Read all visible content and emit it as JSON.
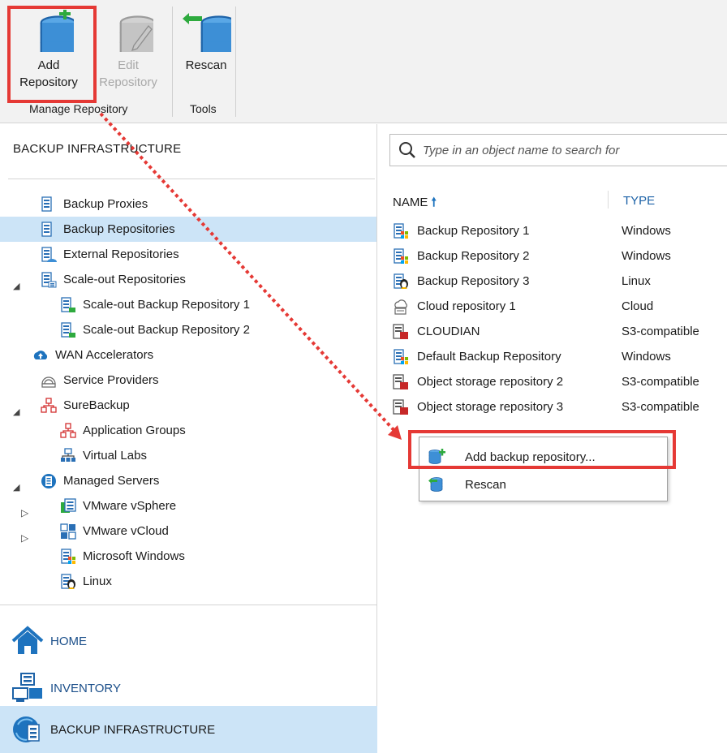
{
  "ribbon": {
    "buttons": {
      "add": {
        "line1": "Add",
        "line2": "Repository"
      },
      "edit": {
        "line1": "Edit",
        "line2": "Repository"
      },
      "rescan": {
        "line1": "Rescan"
      }
    },
    "groups": {
      "manage": "Manage Repository",
      "tools": "Tools"
    }
  },
  "left": {
    "title": "BACKUP INFRASTRUCTURE",
    "tree": [
      {
        "label": "Backup Proxies",
        "icon": "proxy-icon"
      },
      {
        "label": "Backup Repositories",
        "icon": "repository-icon",
        "selected": true
      },
      {
        "label": "External Repositories",
        "icon": "external-repository-icon"
      },
      {
        "label": "Scale-out Repositories",
        "icon": "scaleout-icon",
        "expanded": true
      },
      {
        "label": "Scale-out Backup Repository 1",
        "icon": "scaleout-repo-icon"
      },
      {
        "label": "Scale-out Backup Repository 2",
        "icon": "scaleout-repo-icon"
      },
      {
        "label": "WAN Accelerators",
        "icon": "wan-accelerator-icon"
      },
      {
        "label": "Service Providers",
        "icon": "service-provider-icon"
      },
      {
        "label": "SureBackup",
        "icon": "surebackup-icon",
        "expanded": true
      },
      {
        "label": "Application Groups",
        "icon": "application-group-icon"
      },
      {
        "label": "Virtual Labs",
        "icon": "virtual-lab-icon"
      },
      {
        "label": "Managed Servers",
        "icon": "managed-servers-icon",
        "expanded": true
      },
      {
        "label": "VMware vSphere",
        "icon": "vsphere-icon",
        "collapsed": true
      },
      {
        "label": "VMware vCloud",
        "icon": "vcloud-icon",
        "collapsed": true
      },
      {
        "label": "Microsoft Windows",
        "icon": "windows-server-icon"
      },
      {
        "label": "Linux",
        "icon": "linux-server-icon"
      }
    ],
    "nav": [
      {
        "label": "HOME",
        "icon": "home-icon"
      },
      {
        "label": "INVENTORY",
        "icon": "inventory-icon"
      },
      {
        "label": "BACKUP INFRASTRUCTURE",
        "icon": "backup-infrastructure-icon",
        "selected": true
      }
    ]
  },
  "right": {
    "search": {
      "placeholder": "Type in an object name to search for"
    },
    "columns": {
      "name": "NAME",
      "type": "TYPE"
    },
    "rows": [
      {
        "name": "Backup Repository 1",
        "type": "Windows",
        "icon": "windows-repo-icon"
      },
      {
        "name": "Backup Repository 2",
        "type": "Windows",
        "icon": "windows-repo-icon"
      },
      {
        "name": "Backup Repository 3",
        "type": "Linux",
        "icon": "linux-repo-icon"
      },
      {
        "name": "Cloud repository 1",
        "type": "Cloud",
        "icon": "cloud-repo-icon"
      },
      {
        "name": "CLOUDIAN",
        "type": "S3-compatible",
        "icon": "object-storage-icon"
      },
      {
        "name": "Default Backup Repository",
        "type": "Windows",
        "icon": "windows-repo-icon"
      },
      {
        "name": "Object storage repository 2",
        "type": "S3-compatible",
        "icon": "object-storage-icon"
      },
      {
        "name": "Object storage repository 3",
        "type": "S3-compatible",
        "icon": "object-storage-icon"
      }
    ]
  },
  "context_menu": {
    "items": [
      {
        "label": "Add backup repository...",
        "icon": "add-repository-icon"
      },
      {
        "label": "Rescan",
        "icon": "rescan-icon"
      }
    ]
  },
  "colors": {
    "highlight": "#e53935",
    "selection": "#cce4f7",
    "db_blue": "#3d8fd6",
    "accent_green": "#2eaa3e"
  }
}
